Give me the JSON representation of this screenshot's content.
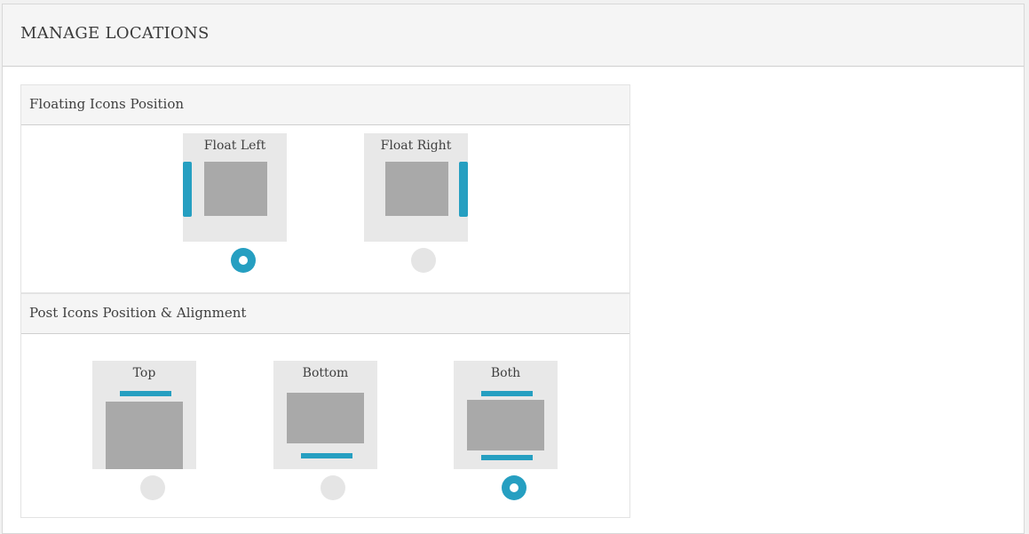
{
  "panel": {
    "title": "MANAGE LOCATIONS"
  },
  "floating": {
    "heading": "Floating Icons Position",
    "options": [
      {
        "label": "Float Left",
        "selected": true
      },
      {
        "label": "Float Right",
        "selected": false
      }
    ]
  },
  "post": {
    "heading": "Post Icons Position & Alignment",
    "options": [
      {
        "label": "Top",
        "selected": false
      },
      {
        "label": "Bottom",
        "selected": false
      },
      {
        "label": "Both",
        "selected": true
      }
    ]
  },
  "colors": {
    "accent": "#269fc1",
    "placeholder": "#a9a9a9",
    "card_bg": "#e8e8e8"
  }
}
